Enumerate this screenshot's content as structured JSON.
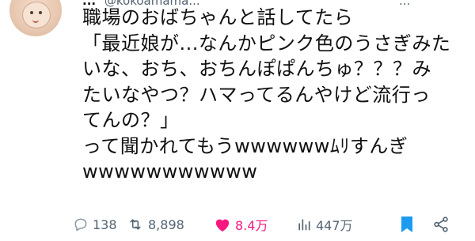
{
  "tweet": {
    "author_name": "...",
    "author_handle": "@kokoamama...",
    "more_label": "...",
    "lines": [
      "職場のおばちゃんと話してたら",
      "「最近娘が...なんかピンク色のうさぎみた",
      "いな、おち、おちんぽぱんちゅ？？？み",
      "たいなやつ？ハマってるんやけど流行っ",
      "てんの？」",
      "って聞かれてもうwwwwwwﾑﾘすんぎ",
      "wwwwwwwwwww"
    ]
  },
  "actions": {
    "reply": {
      "icon": "reply-icon",
      "count": "138"
    },
    "retweet": {
      "icon": "retweet-icon",
      "count": "8,898"
    },
    "like": {
      "icon": "heart-icon",
      "count": "8.4万"
    },
    "views": {
      "icon": "views-icon",
      "count": "447万"
    },
    "bookmark": {
      "icon": "bookmark-icon"
    },
    "share": {
      "icon": "share-icon"
    }
  },
  "colors": {
    "text": "#111111",
    "muted": "#536471",
    "like": "#f91880",
    "bookmark": "#1d9bf0"
  }
}
